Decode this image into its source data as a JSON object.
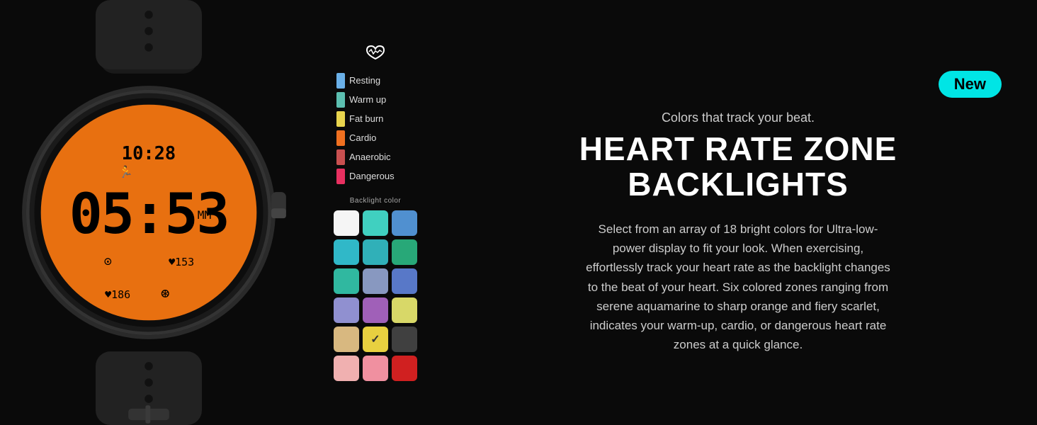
{
  "badge": {
    "label": "New"
  },
  "subtitle": "Colors that track your beat.",
  "title": "HEART RATE ZONE\nBACKLIGHTS",
  "description": "Select from an array of 18 bright colors for Ultra-low-power display to fit your look. When exercising, effortlessly track your heart rate as the backlight changes to the beat of your heart. Six colored zones ranging from serene aquamarine to sharp orange and fiery scarlet, indicates your warm-up, cardio, or dangerous heart rate zones at a quick glance.",
  "zones": {
    "label": "Backlight color",
    "heart_icon": "♡",
    "items": [
      {
        "name": "Resting",
        "color": "#6ab0e8"
      },
      {
        "name": "Warm up",
        "color": "#5cbfb0"
      },
      {
        "name": "Fat burn",
        "color": "#e8d44d"
      },
      {
        "name": "Cardio",
        "color": "#f07020"
      },
      {
        "name": "Anaerobic",
        "color": "#c85050"
      },
      {
        "name": "Dangerous",
        "color": "#e83060"
      }
    ]
  },
  "color_swatches": [
    {
      "color": "#f5f5f5",
      "checked": false
    },
    {
      "color": "#40d0c0",
      "checked": false
    },
    {
      "color": "#5090d0",
      "checked": false
    },
    {
      "color": "#30b8c8",
      "checked": false
    },
    {
      "color": "#30b0b8",
      "checked": false
    },
    {
      "color": "#28a878",
      "checked": false
    },
    {
      "color": "#30b8a0",
      "checked": false
    },
    {
      "color": "#8898c0",
      "checked": false
    },
    {
      "color": "#5878c8",
      "checked": false
    },
    {
      "color": "#9090d0",
      "checked": false
    },
    {
      "color": "#a060b8",
      "checked": false
    },
    {
      "color": "#d8d868",
      "checked": false
    },
    {
      "color": "#d8b880",
      "checked": false
    },
    {
      "color": "#e8d040",
      "checked": true
    },
    {
      "color": "#404040",
      "checked": false
    },
    {
      "color": "#f0b0b0",
      "checked": false
    },
    {
      "color": "#f090a0",
      "checked": false
    },
    {
      "color": "#d02020",
      "checked": false
    }
  ]
}
